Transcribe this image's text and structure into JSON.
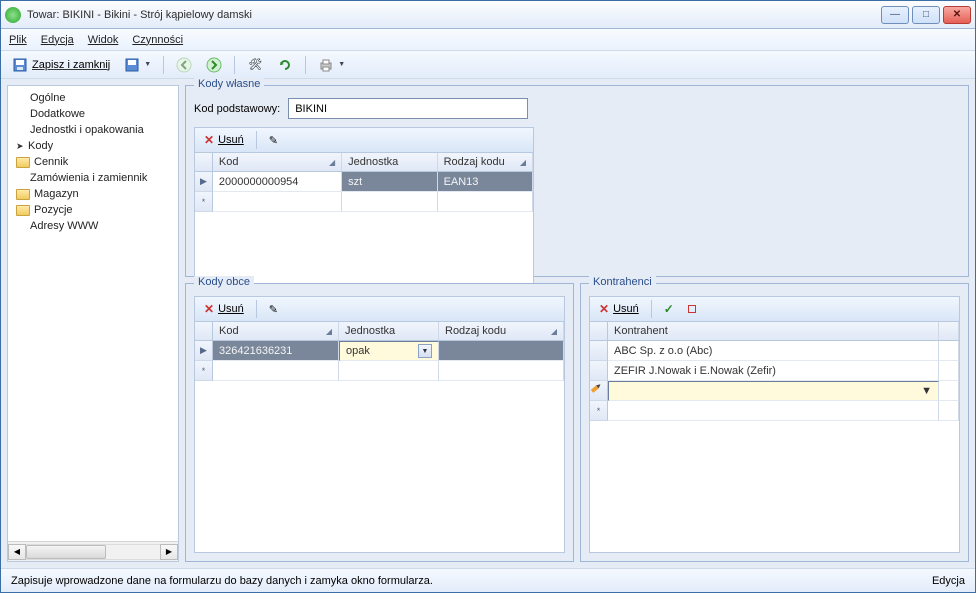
{
  "window": {
    "title": "Towar: BIKINI - Bikini - Strój kąpielowy damski"
  },
  "menu": {
    "plik": "Plik",
    "edycja": "Edycja",
    "widok": "Widok",
    "czynnosci": "Czynności"
  },
  "toolbar": {
    "save_close": "Zapisz i zamknij"
  },
  "sidebar": {
    "items": [
      {
        "label": "Ogólne"
      },
      {
        "label": "Dodatkowe"
      },
      {
        "label": "Jednostki i opakowania"
      },
      {
        "label": "Kody"
      },
      {
        "label": "Cennik"
      },
      {
        "label": "Zamówienia i zamiennik"
      },
      {
        "label": "Magazyn"
      },
      {
        "label": "Pozycje"
      },
      {
        "label": "Adresy WWW"
      }
    ]
  },
  "kody_wlasne": {
    "legend": "Kody własne",
    "kod_podstawowy_label": "Kod podstawowy:",
    "kod_podstawowy_value": "BIKINI",
    "usun": "Usuń",
    "cols": {
      "kod": "Kod",
      "jednostka": "Jednostka",
      "rodzaj": "Rodzaj kodu"
    },
    "row0": {
      "kod": "2000000000954",
      "jednostka": "szt",
      "rodzaj": "EAN13"
    }
  },
  "kody_obce": {
    "legend": "Kody obce",
    "usun": "Usuń",
    "cols": {
      "kod": "Kod",
      "jednostka": "Jednostka",
      "rodzaj": "Rodzaj kodu"
    },
    "row0": {
      "kod": "326421636231",
      "jednostka": "opak",
      "rodzaj": ""
    }
  },
  "kontrahenci": {
    "legend": "Kontrahenci",
    "usun": "Usuń",
    "cols": {
      "kontrahent": "Kontrahent"
    },
    "rows": [
      {
        "val": "ABC Sp. z o.o (Abc)"
      },
      {
        "val": "ZEFIR J.Nowak i E.Nowak (Zefir)"
      }
    ]
  },
  "statusbar": {
    "hint": "Zapisuje wprowadzone dane na formularzu do bazy danych i zamyka okno formularza.",
    "mode": "Edycja"
  }
}
